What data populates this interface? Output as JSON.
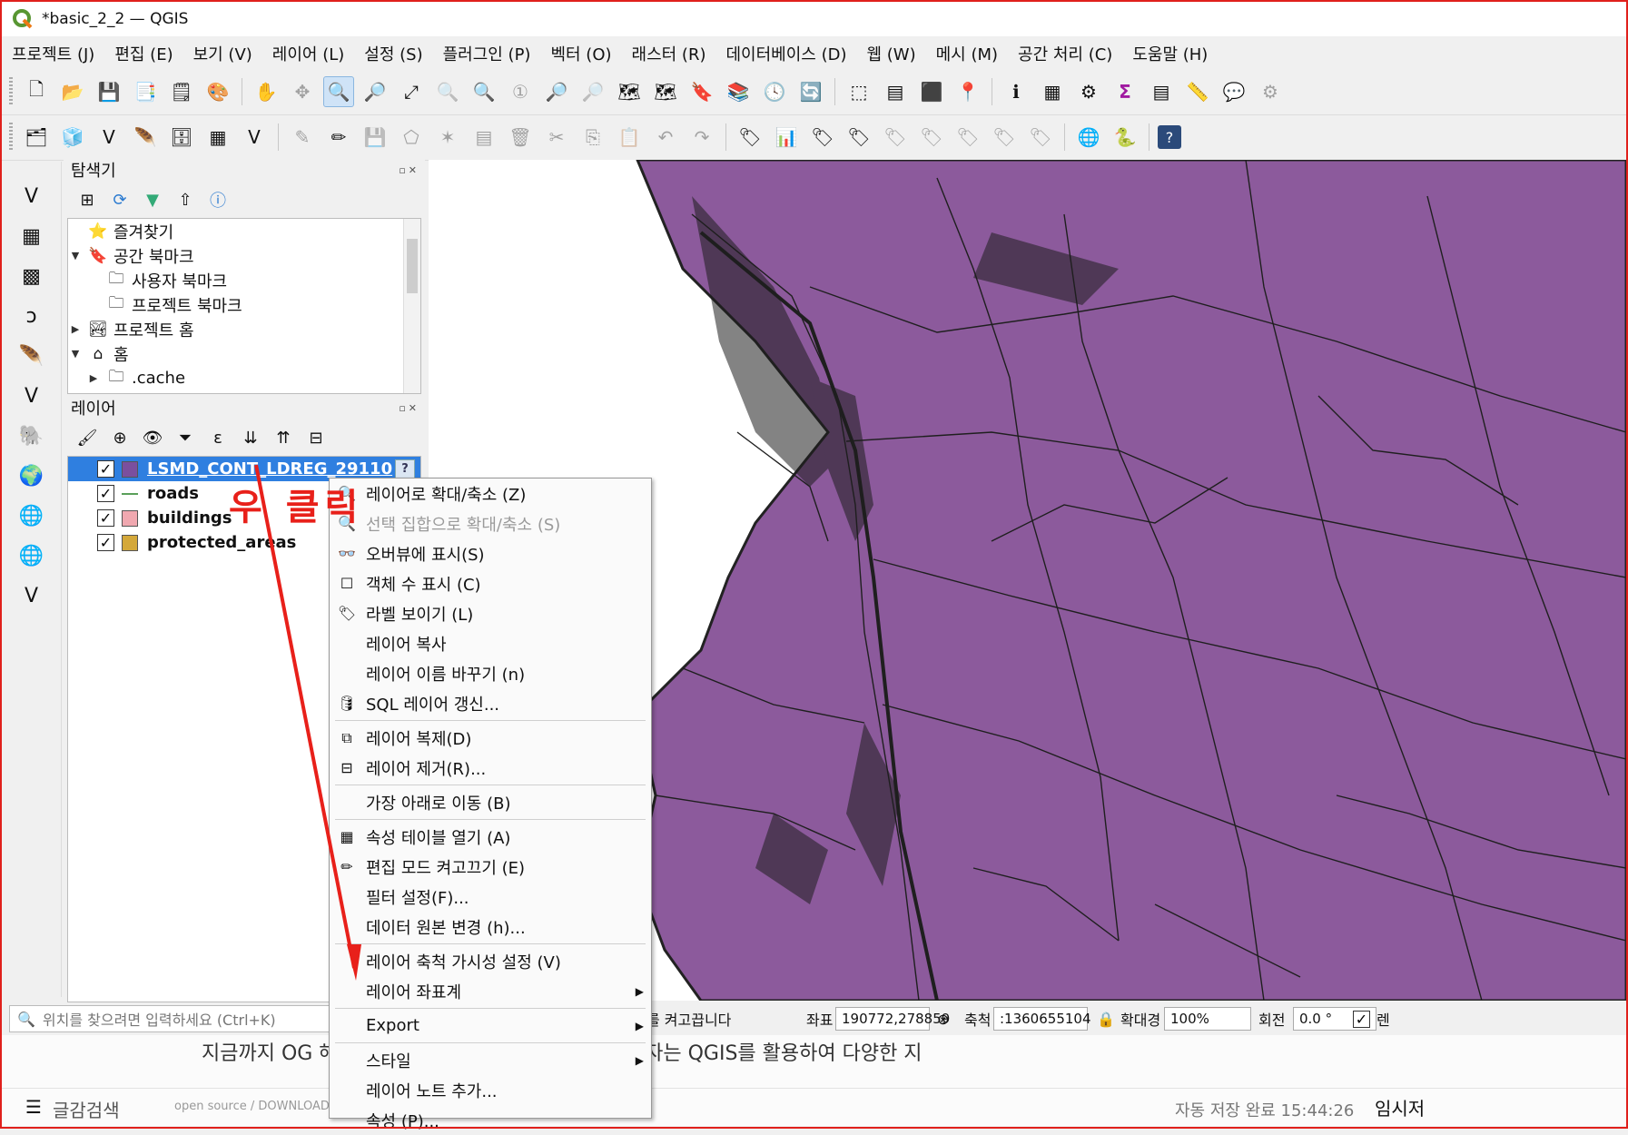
{
  "window": {
    "title": "*basic_2_2 — QGIS"
  },
  "menu": [
    "프로젝트 (J)",
    "편집 (E)",
    "보기 (V)",
    "레이어 (L)",
    "설정 (S)",
    "플러그인 (P)",
    "벡터 (O)",
    "래스터 (R)",
    "데이터베이스 (D)",
    "웹 (W)",
    "메시 (M)",
    "공간 처리 (C)",
    "도움말 (H)"
  ],
  "browser": {
    "title": "탐색기",
    "items": [
      {
        "label": "즐겨찾기",
        "icon": "star-icon",
        "indent": 0,
        "arrow": ""
      },
      {
        "label": "공간 북마크",
        "icon": "bookmark-icon",
        "indent": 0,
        "arrow": "▼"
      },
      {
        "label": "사용자 북마크",
        "icon": "folder-icon",
        "indent": 1,
        "arrow": ""
      },
      {
        "label": "프로젝트 북마크",
        "icon": "folder-icon",
        "indent": 1,
        "arrow": ""
      },
      {
        "label": "프로젝트 홈",
        "icon": "project-home-icon",
        "indent": 0,
        "arrow": "▶"
      },
      {
        "label": "홈",
        "icon": "home-icon",
        "indent": 0,
        "arrow": "▼"
      },
      {
        "label": ".cache",
        "icon": "folder-icon",
        "indent": 1,
        "arrow": "▶"
      }
    ]
  },
  "layers": {
    "title": "레이어",
    "items": [
      {
        "label": "LSMD_CONT_LDREG_29110",
        "checked": true,
        "swatch": "#7b4f9e",
        "selected": true
      },
      {
        "label": "roads",
        "checked": true,
        "swatch": "line",
        "selected": false
      },
      {
        "label": "buildings",
        "checked": true,
        "swatch": "#f0a8b0",
        "selected": false
      },
      {
        "label": "protected_areas",
        "checked": true,
        "swatch": "#d4a83a",
        "selected": false
      }
    ]
  },
  "annotation": "우 클릭",
  "context_menu": [
    {
      "label": "레이어로 확대/축소 (Z)",
      "icon": "zoom-to-layer-icon",
      "disabled": false
    },
    {
      "label": "선택 집합으로 확대/축소 (S)",
      "icon": "zoom-to-selection-icon",
      "disabled": true
    },
    {
      "label": "오버뷰에 표시(S)",
      "icon": "overview-icon",
      "disabled": false
    },
    {
      "label": "객체 수 표시 (C)",
      "icon": "checkbox-icon",
      "disabled": false
    },
    {
      "label": "라벨 보이기 (L)",
      "icon": "label-icon",
      "disabled": false
    },
    {
      "label": "레이어 복사",
      "icon": "",
      "disabled": false
    },
    {
      "label": "레이어 이름 바꾸기 (n)",
      "icon": "",
      "disabled": false
    },
    {
      "label": "SQL 레이어 갱신...",
      "icon": "database-icon",
      "disabled": false,
      "sep_after": true
    },
    {
      "label": "레이어 복제(D)",
      "icon": "duplicate-layer-icon",
      "disabled": false
    },
    {
      "label": "레이어 제거(R)...",
      "icon": "remove-layer-icon",
      "disabled": false,
      "sep_after": true
    },
    {
      "label": "가장 아래로 이동 (B)",
      "icon": "",
      "disabled": false,
      "sep_after": true
    },
    {
      "label": "속성 테이블 열기 (A)",
      "icon": "attribute-table-icon",
      "disabled": false
    },
    {
      "label": "편집 모드 켜고끄기 (E)",
      "icon": "pencil-icon",
      "disabled": false
    },
    {
      "label": "필터 설정(F)...",
      "icon": "",
      "disabled": false
    },
    {
      "label": "데이터 원본 변경 (h)...",
      "icon": "",
      "disabled": false,
      "sep_after": true
    },
    {
      "label": "레이어 축척 가시성 설정 (V)",
      "icon": "",
      "disabled": false
    },
    {
      "label": "레이어 좌표계",
      "icon": "",
      "disabled": false,
      "submenu": true,
      "sep_after": true
    },
    {
      "label": "Export",
      "icon": "",
      "disabled": false,
      "submenu": true,
      "sep_after": true
    },
    {
      "label": "스타일",
      "icon": "",
      "disabled": false,
      "submenu": true
    },
    {
      "label": "레이어 노트 추가...",
      "icon": "",
      "disabled": false
    },
    {
      "label": "속성 (P)...",
      "icon": "",
      "disabled": false
    }
  ],
  "status": {
    "search_placeholder": "위치를 찾으려면 입력하세요 (Ctrl+K)",
    "message": "를 켜고끕니다",
    "coord_label": "좌표",
    "coord_value": "190772,278859",
    "scale_label": "축척",
    "scale_value": ":1360655104",
    "magnifier_label": "확대경",
    "magnifier_value": "100%",
    "rotation_label": "회전",
    "rotation_value": "0.0 °",
    "render_label": "렌"
  },
  "background_doc": {
    "text": "지금까지 OG                             해 알아보았습니다. 이를 바탕으로 사용자는 QGIS를 활용하여 다양한 지",
    "search_label": "글감검색",
    "source": "open source / DOWNLOAD",
    "autosave": "자동 저장 완료 15:44:26",
    "temp": "임시저"
  },
  "colors": {
    "map_fill": "#8c5a9c",
    "selection": "#2f7fe0",
    "annotation": "#e8201a"
  }
}
